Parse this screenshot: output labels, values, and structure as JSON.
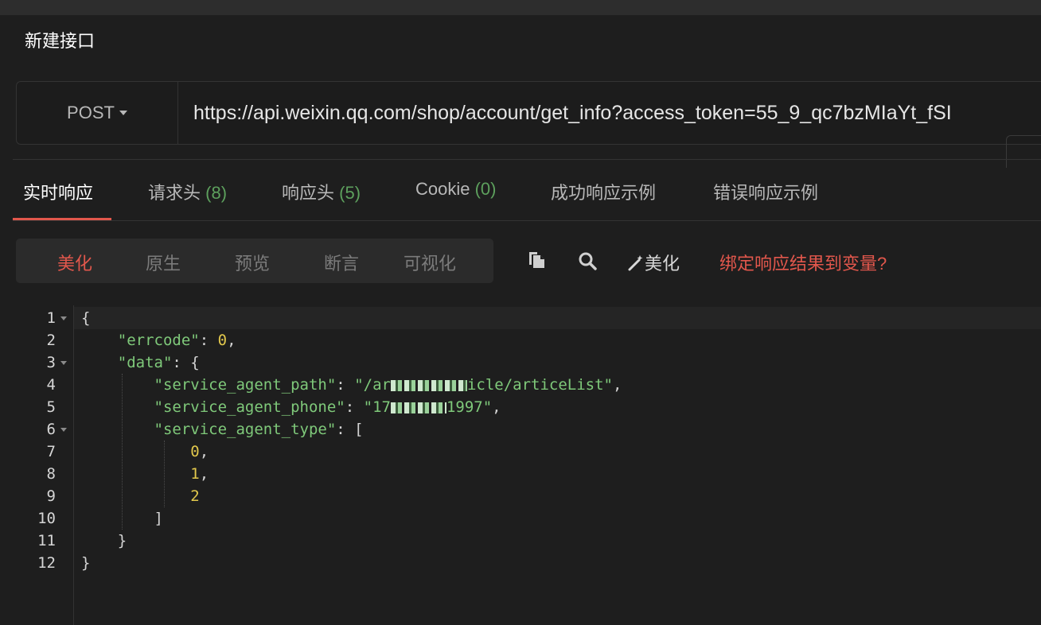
{
  "page": {
    "title": "新建接口"
  },
  "request": {
    "method": "POST",
    "url": "https://api.weixin.qq.com/shop/account/get_info?access_token=55_9_qc7bzMIaYt_fSI"
  },
  "response_tabs": [
    {
      "label": "实时响应",
      "count": ""
    },
    {
      "label": "请求头",
      "count": "(8)"
    },
    {
      "label": "响应头",
      "count": "(5)"
    },
    {
      "label": "Cookie",
      "count": "(0)"
    },
    {
      "label": "成功响应示例",
      "count": ""
    },
    {
      "label": "错误响应示例",
      "count": ""
    }
  ],
  "view_modes": [
    "美化",
    "原生",
    "预览",
    "断言",
    "可视化"
  ],
  "toolbar": {
    "beautify_label": "美化",
    "bind_link": "绑定响应结果到变量?"
  },
  "icons": {
    "copy": "copy-icon",
    "search": "search-icon",
    "magic": "magic-wand-icon"
  },
  "colors": {
    "accent": "#e2574c",
    "string": "#7fc97a",
    "number": "#e2c84c",
    "count": "#5da05d"
  },
  "editor": {
    "line_numbers": [
      "1",
      "2",
      "3",
      "4",
      "5",
      "6",
      "7",
      "8",
      "9",
      "10",
      "11",
      "12"
    ],
    "keys": {
      "errcode": "\"errcode\"",
      "data": "\"data\"",
      "service_agent_path": "\"service_agent_path\"",
      "service_agent_phone": "\"service_agent_phone\"",
      "service_agent_type": "\"service_agent_type\""
    },
    "values": {
      "errcode": "0",
      "path_prefix": "\"/ar",
      "path_suffix": "icle/articeList\"",
      "phone_prefix": "\"17",
      "phone_suffix": "1997\"",
      "type_0": "0",
      "type_1": "1",
      "type_2": "2"
    }
  }
}
